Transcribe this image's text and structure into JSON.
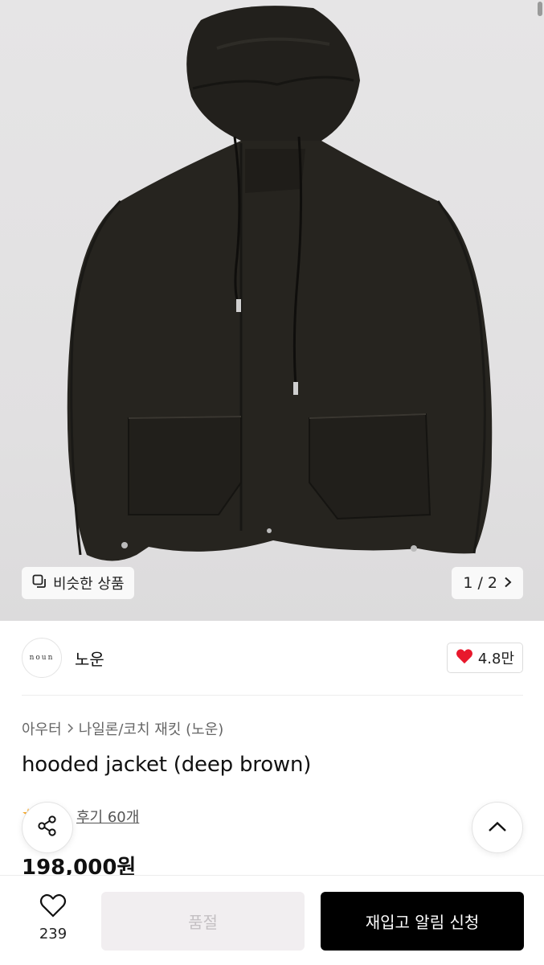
{
  "gallery": {
    "image_alt": "hooded jacket (deep brown)",
    "similar_label": "비슷한 상품",
    "page_indicator": "1 / 2"
  },
  "brand": {
    "logo_text": "noun",
    "name": "노운",
    "likes": "4.8만"
  },
  "product": {
    "breadcrumb": [
      "아우터",
      "나일론/코치 재킷 (노운)"
    ],
    "title": "hooded jacket (deep brown)",
    "reviews": "후기 60개",
    "price": "198,000원"
  },
  "bottom_bar": {
    "wish_count": "239",
    "soldout_label": "품절",
    "restock_label": "재입고 알림 신청"
  },
  "colors": {
    "accent_red": "#e8182c",
    "star": "#f6a623",
    "primary_button": "#000000",
    "disabled_button": "#f1eef0"
  }
}
